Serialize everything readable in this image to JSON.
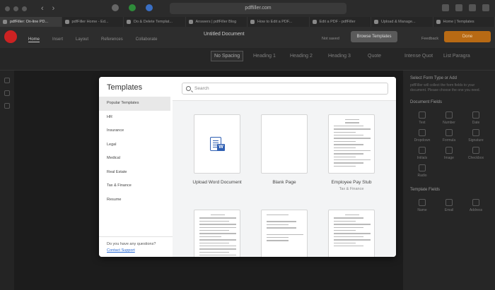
{
  "browser": {
    "url": "pdffiller.com",
    "tabs": [
      "pdfFiller: On-line PD...",
      "pdfFiller Home - Ed...",
      "Do & Delete Templat...",
      "Answers | pdfFiller Blog",
      "How to Edit a PDF...",
      "Edit a PDF - pdfFiller",
      "Upload & Manage...",
      "Home | Templates"
    ]
  },
  "app": {
    "document_title": "Untitled Document",
    "menu_tabs": [
      "Home",
      "Insert",
      "Layout",
      "References",
      "Collaborate"
    ],
    "save_status": "Not saved",
    "browse_templates": "Browse Templates",
    "feedback": "Feedback",
    "done": "Done"
  },
  "style_bar": {
    "styles": [
      "No Spacing",
      "Heading 1",
      "Heading 2",
      "Heading 3",
      "Quote",
      "Intense Quot",
      "List Paragra"
    ]
  },
  "right_panel": {
    "title": "Select Form Type or Add",
    "description": "pdfFiller will collect the form fields to your document. Please choose the one you need.",
    "document_fields_title": "Document Fields",
    "document_fields": [
      "Text",
      "Number",
      "Date",
      "Dropdown",
      "Formula",
      "Signature",
      "Initials",
      "Image",
      "Checkbox",
      "Radio"
    ],
    "template_fields_title": "Template Fields",
    "template_fields": [
      "Name",
      "Email",
      "Address",
      "Date",
      "Signature",
      "Initials"
    ]
  },
  "modal": {
    "title": "Templates",
    "search": {
      "placeholder": "Search"
    },
    "categories": [
      "Popular Templates",
      "HR",
      "Insurance",
      "Legal",
      "Medical",
      "Real Estate",
      "Tax & Finance",
      "Resume"
    ],
    "selected_category": "Popular Templates",
    "help_question": "Do you have any questions?",
    "help_link": "Contact Support",
    "cards": [
      {
        "label": "Upload Word Document",
        "sub": ""
      },
      {
        "label": "Blank Page",
        "sub": ""
      },
      {
        "label": "Employee Pay Stub",
        "sub": "Tax & Finance"
      },
      {
        "label": "",
        "sub": ""
      },
      {
        "label": "",
        "sub": ""
      },
      {
        "label": "",
        "sub": ""
      }
    ]
  },
  "colors": {
    "modal_bg": "#ffffff",
    "selected_category_bg": "#e8e8e8",
    "link": "#2a6bd6",
    "word_icon": "#2f5fb3",
    "done_button": "#b86a14"
  }
}
